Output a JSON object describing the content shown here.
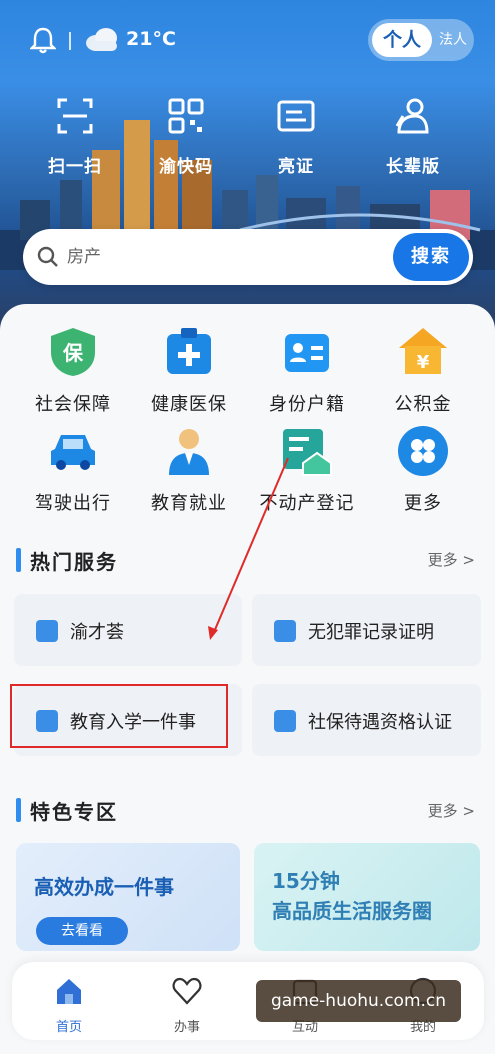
{
  "header": {
    "temperature": "21°C",
    "mode_personal": "个人",
    "mode_legal": "法人"
  },
  "quick_actions": [
    {
      "label": "扫一扫",
      "icon": "scan-icon"
    },
    {
      "label": "渝快码",
      "icon": "qr-code-icon"
    },
    {
      "label": "亮证",
      "icon": "id-card-icon"
    },
    {
      "label": "长辈版",
      "icon": "elder-mode-icon"
    }
  ],
  "search": {
    "placeholder": "房产",
    "button": "搜索"
  },
  "services_grid": [
    {
      "label": "社会保障",
      "icon": "social-security-icon",
      "color": "#3cb371"
    },
    {
      "label": "健康医保",
      "icon": "health-insurance-icon",
      "color": "#1e88e5"
    },
    {
      "label": "身份户籍",
      "icon": "identity-icon",
      "color": "#2196f3"
    },
    {
      "label": "公积金",
      "icon": "housing-fund-icon",
      "color": "#f5a623"
    },
    {
      "label": "驾驶出行",
      "icon": "car-icon",
      "color": "#1e88e5"
    },
    {
      "label": "教育就业",
      "icon": "employment-icon",
      "color": "#1e88e5"
    },
    {
      "label": "不动产登记",
      "icon": "real-estate-icon",
      "color": "#26a69a"
    },
    {
      "label": "更多",
      "icon": "more-icon",
      "color": "#1e88e5"
    }
  ],
  "hot_services": {
    "title": "热门服务",
    "more": "更多",
    "items": [
      {
        "label": "渝才荟"
      },
      {
        "label": "无犯罪记录证明"
      },
      {
        "label": "教育入学一件事"
      },
      {
        "label": "社保待遇资格认证"
      }
    ]
  },
  "featured": {
    "title": "特色专区",
    "more": "更多",
    "cards": [
      {
        "title": "高效办成一件事",
        "button": "去看看"
      },
      {
        "title_line1": "15分钟",
        "title_line2": "高品质生活服务圈"
      }
    ]
  },
  "bottom_nav": [
    {
      "label": "首页",
      "icon": "home-icon",
      "active": true
    },
    {
      "label": "办事",
      "icon": "heart-icon",
      "active": false
    },
    {
      "label": "互动",
      "icon": "interact-icon",
      "active": false
    },
    {
      "label": "我的",
      "icon": "profile-icon",
      "active": false
    }
  ],
  "watermark": "game-huohu.com.cn",
  "colors": {
    "primary": "#1976e6",
    "accent_bar": "#2f8df0",
    "annotation": "#e02a2a"
  }
}
